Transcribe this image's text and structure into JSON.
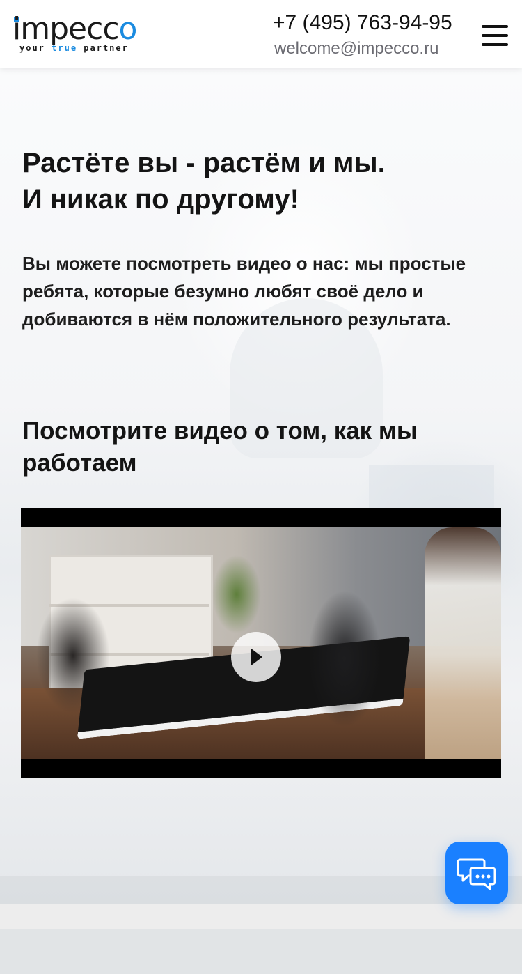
{
  "header": {
    "logo_text": "impecco",
    "logo_tagline_prefix": "your",
    "logo_tagline_accent": "true",
    "logo_tagline_suffix": "partner",
    "phone": "+7 (495) 763-94-95",
    "email": "welcome@impecco.ru",
    "menu_icon": "hamburger-menu-icon"
  },
  "hero": {
    "title_line1": "Растёте вы - растём и мы.",
    "title_line2": "И никак по другому!",
    "description": "Вы можете посмотреть видео о нас: мы простые ребята, которые безумно любят своё дело и добиваются в нём положительного результата."
  },
  "video_section": {
    "title": "Посмотрите видео о том, как мы работаем",
    "play_icon": "play-icon"
  },
  "chat_widget": {
    "icon": "chat-bubbles-icon"
  },
  "colors": {
    "accent": "#1a8be0",
    "chat_button": "#1a80ff",
    "text": "#141414",
    "email_text": "#6b6b72"
  }
}
